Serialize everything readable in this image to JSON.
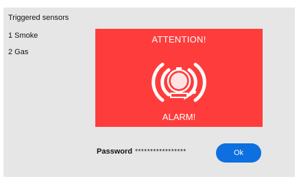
{
  "triggered_sensors": {
    "title": "Triggered sensors",
    "items": [
      {
        "label": "1 Smoke"
      },
      {
        "label": "2 Gas"
      }
    ]
  },
  "alarm_panel": {
    "top_text": "ATTENTION!",
    "bottom_text": "ALARM!",
    "icon": "alarm-bell-icon",
    "background_color": "#ff3c3c"
  },
  "password": {
    "label": "Password",
    "value": "*****************"
  },
  "ok_button": {
    "label": "Ok",
    "color": "#0d6fe0"
  }
}
